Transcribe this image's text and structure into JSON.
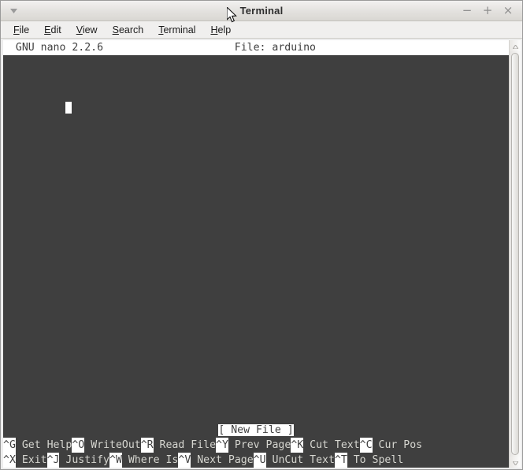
{
  "window": {
    "title": "Terminal",
    "menu_arrow_icon": "chevron-down-icon",
    "controls": {
      "minimize": "−",
      "maximize": "+",
      "close": "×"
    }
  },
  "menubar": {
    "items": [
      {
        "mnemonic": "F",
        "rest": "ile"
      },
      {
        "mnemonic": "E",
        "rest": "dit"
      },
      {
        "mnemonic": "V",
        "rest": "iew"
      },
      {
        "mnemonic": "S",
        "rest": "earch"
      },
      {
        "mnemonic": "T",
        "rest": "erminal"
      },
      {
        "mnemonic": "H",
        "rest": "elp"
      }
    ]
  },
  "nano": {
    "header_left": "  GNU nano 2.2.6",
    "header_file": "File: arduino",
    "header_full": "  GNU nano 2.2.6                     File: arduino",
    "editor_lines": [
      ""
    ],
    "cursor": {
      "line": 0,
      "column": 0
    },
    "status": "[ New File ]",
    "shortcuts_row1": [
      {
        "key": "^G",
        "label": " Get Help"
      },
      {
        "key": "^O",
        "label": " WriteOut"
      },
      {
        "key": "^R",
        "label": " Read File"
      },
      {
        "key": "^Y",
        "label": " Prev Page"
      },
      {
        "key": "^K",
        "label": " Cut Text"
      },
      {
        "key": "^C",
        "label": " Cur Pos"
      }
    ],
    "shortcuts_row2": [
      {
        "key": "^X",
        "label": " Exit"
      },
      {
        "key": "^J",
        "label": " Justify"
      },
      {
        "key": "^W",
        "label": " Where Is"
      },
      {
        "key": "^V",
        "label": " Next Page"
      },
      {
        "key": "^U",
        "label": " UnCut Text"
      },
      {
        "key": "^T",
        "label": " To Spell"
      }
    ]
  },
  "scrollbar": {
    "up_arrow_icon": "triangle-up-icon",
    "down_arrow_icon": "triangle-down-icon"
  },
  "colors": {
    "terminal_bg": "#3f3f3f",
    "terminal_fg": "#d6d6d0",
    "inverse_bg": "#ffffff",
    "titlebar_bg": "#e3e1de"
  }
}
